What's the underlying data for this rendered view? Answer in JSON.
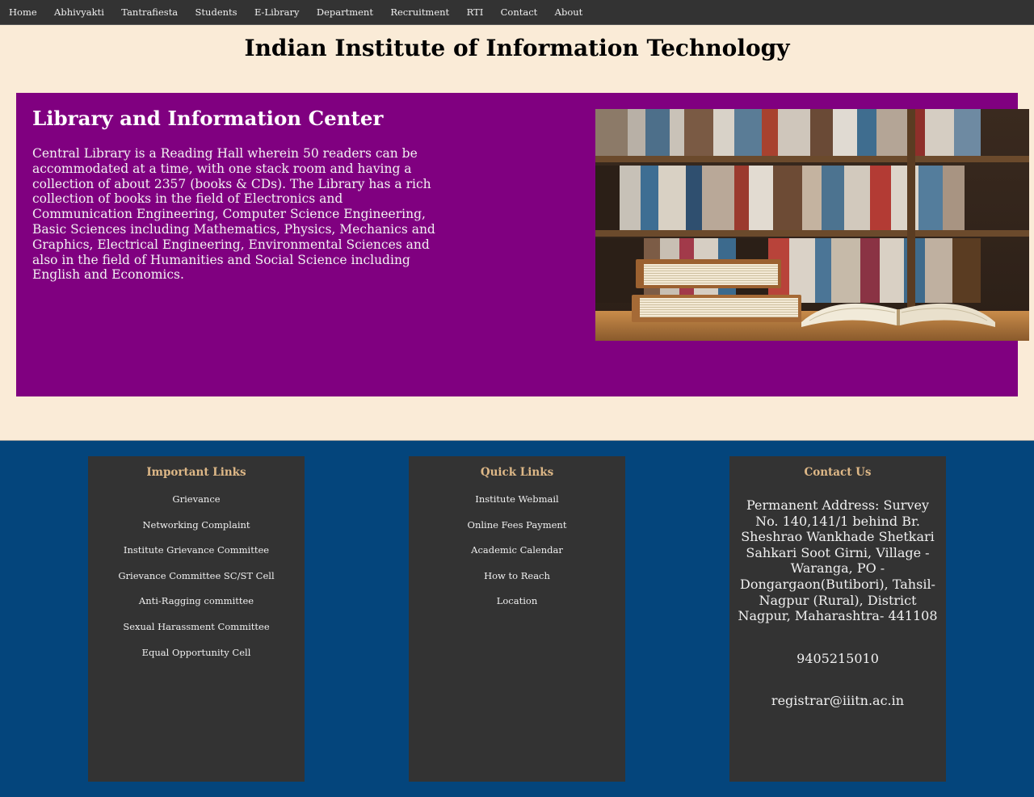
{
  "nav": {
    "items": [
      {
        "label": "Home"
      },
      {
        "label": "Abhivyakti"
      },
      {
        "label": "Tantrafiesta"
      },
      {
        "label": "Students"
      },
      {
        "label": "E-Library"
      },
      {
        "label": "Department"
      },
      {
        "label": "Recruitment"
      },
      {
        "label": "RTI"
      },
      {
        "label": "Contact"
      },
      {
        "label": "About"
      }
    ]
  },
  "site": {
    "title": "Indian Institute of Information Technology"
  },
  "library": {
    "heading": "Library and Information Center",
    "description": "Central Library is a Reading Hall wherein 50 readers can be accommodated at a time, with one stack room and having a collection of about 2357 (books & CDs). The Library has a rich collection of books in the field of Electronics and Communication Engineering, Computer Science Engineering, Basic Sciences including Mathematics, Physics, Mechanics and Graphics, Electrical Engineering, Environmental Sciences and also in the field of Humanities and Social Science including English and Economics.",
    "image_icon": "bookshelf-photo"
  },
  "footer": {
    "important_links": {
      "title": "Important Links",
      "items": [
        {
          "label": "Grievance"
        },
        {
          "label": "Networking Complaint"
        },
        {
          "label": "Institute Grievance Committee"
        },
        {
          "label": "Grievance Committee SC/ST Cell"
        },
        {
          "label": "Anti-Ragging committee"
        },
        {
          "label": "Sexual Harassment Committee"
        },
        {
          "label": "Equal Opportunity Cell"
        }
      ]
    },
    "quick_links": {
      "title": "Quick Links",
      "items": [
        {
          "label": "Institute Webmail"
        },
        {
          "label": "Online Fees Payment"
        },
        {
          "label": "Academic Calendar"
        },
        {
          "label": "How to Reach"
        },
        {
          "label": "Location"
        }
      ]
    },
    "contact": {
      "title": "Contact Us",
      "address": "Permanent Address: Survey No. 140,141/1 behind Br. Sheshrao Wankhade Shetkari Sahkari Soot Girni, Village - Waranga, PO - Dongargaon(Butibori), Tahsil- Nagpur (Rural), District Nagpur, Maharashtra- 441108",
      "phone": "9405215010",
      "email": "registrar@iiitn.ac.in"
    }
  },
  "colors": {
    "nav_bg": "#333333",
    "page_bg": "#faebd7",
    "library_bg": "#800080",
    "footer_bg": "#04457c",
    "card_bg": "#333333",
    "card_heading": "#deb887"
  }
}
